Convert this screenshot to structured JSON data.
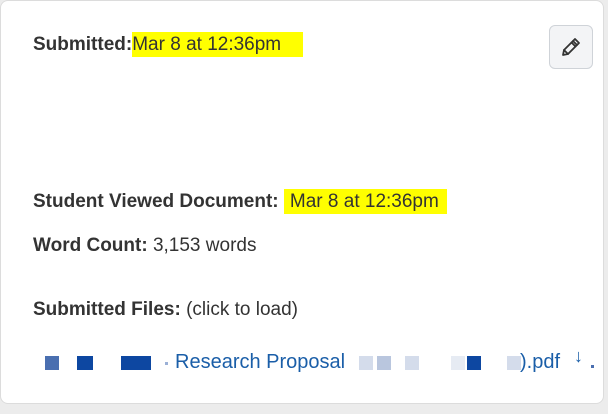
{
  "submission": {
    "submitted_label": "Submitted:",
    "submitted_value": "Mar 8 at 12:36pm",
    "viewed_label": "Student Viewed Document:",
    "viewed_value": "Mar 8 at 12:36pm",
    "word_count_label": "Word Count:",
    "word_count_value": "3,153 words",
    "files_label": "Submitted Files:",
    "files_hint": "(click to load)"
  },
  "file": {
    "name_visible": "Research Proposal",
    "suffix_visible": ").pdf"
  },
  "icons": {
    "edit": "pencil-icon",
    "download": "download-arrow-icon"
  },
  "colors": {
    "highlight": "#ffff00",
    "link": "#1a5ea8",
    "redaction_dark": "#0d47a1",
    "redaction_light": "#b9c6de"
  }
}
